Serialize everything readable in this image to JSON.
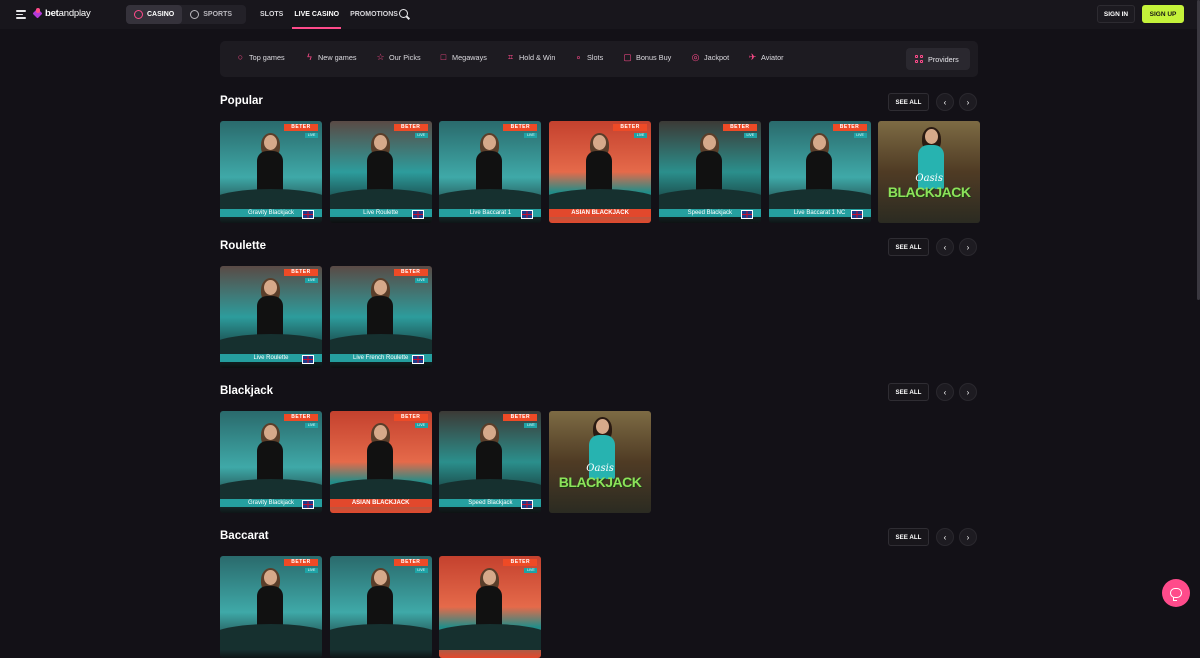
{
  "header": {
    "brand": {
      "name_bold": "bet",
      "name_rest": "andplay"
    },
    "segments": [
      {
        "label": "CASINO",
        "icon": "club-icon",
        "active": true
      },
      {
        "label": "SPORTS",
        "icon": "ball-icon",
        "active": false
      }
    ],
    "nav": [
      {
        "label": "SLOTS",
        "active": false
      },
      {
        "label": "LIVE CASINO",
        "active": true
      },
      {
        "label": "PROMOTIONS",
        "active": false
      }
    ],
    "sign_in": "SIGN IN",
    "sign_up": "SIGN UP",
    "accent_color": "#ff4b8b",
    "signup_color": "#c4f23a"
  },
  "categories": [
    {
      "label": "Top games",
      "icon": "flame-icon"
    },
    {
      "label": "New games",
      "icon": "bolt-icon"
    },
    {
      "label": "Our Picks",
      "icon": "star-icon"
    },
    {
      "label": "Megaways",
      "icon": "megaways-icon"
    },
    {
      "label": "Hold & Win",
      "icon": "hold-win-icon"
    },
    {
      "label": "Slots",
      "icon": "cherries-icon"
    },
    {
      "label": "Bonus Buy",
      "icon": "bag-icon"
    },
    {
      "label": "Jackpot",
      "icon": "jackpot-icon"
    },
    {
      "label": "Aviator",
      "icon": "plane-icon"
    }
  ],
  "providers_label": "Providers",
  "see_all": "SEE ALL",
  "sections": [
    {
      "title": "Popular",
      "games": [
        {
          "name": "Gravity Blackjack",
          "style": "teal",
          "flag": true,
          "label_red": false
        },
        {
          "name": "Live Roulette",
          "style": "teal2",
          "flag": true,
          "label_red": false
        },
        {
          "name": "Live Baccarat 1",
          "style": "teal",
          "flag": true,
          "label_red": false
        },
        {
          "name": "ASIAN BLACKJACK",
          "style": "red",
          "flag": false,
          "label_red": true
        },
        {
          "name": "Speed Blackjack",
          "style": "dark",
          "flag": true,
          "label_red": false
        },
        {
          "name": "Live Baccarat 1 NC",
          "style": "teal",
          "flag": true,
          "label_red": false
        },
        {
          "name": "BLACKJACK",
          "style": "oasis",
          "flag": false,
          "label_red": false,
          "oasis_script": "Oasis"
        }
      ]
    },
    {
      "title": "Roulette",
      "games": [
        {
          "name": "Live Roulette",
          "style": "teal2",
          "flag": true,
          "label_red": false
        },
        {
          "name": "Live French Roulette",
          "style": "teal2",
          "flag": true,
          "label_red": false
        }
      ]
    },
    {
      "title": "Blackjack",
      "games": [
        {
          "name": "Gravity Blackjack",
          "style": "teal",
          "flag": true,
          "label_red": false
        },
        {
          "name": "ASIAN BLACKJACK",
          "style": "red",
          "flag": false,
          "label_red": true
        },
        {
          "name": "Speed Blackjack",
          "style": "dark",
          "flag": true,
          "label_red": false
        },
        {
          "name": "BLACKJACK",
          "style": "oasis",
          "flag": false,
          "label_red": false,
          "oasis_script": "Oasis"
        }
      ]
    },
    {
      "title": "Baccarat",
      "games": [
        {
          "name": "",
          "style": "teal",
          "flag": false,
          "label_red": false
        },
        {
          "name": "",
          "style": "teal",
          "flag": false,
          "label_red": false
        },
        {
          "name": "",
          "style": "red",
          "flag": false,
          "label_red": false
        }
      ]
    }
  ],
  "tile_brand": "BETER",
  "tile_live": "LIVE"
}
